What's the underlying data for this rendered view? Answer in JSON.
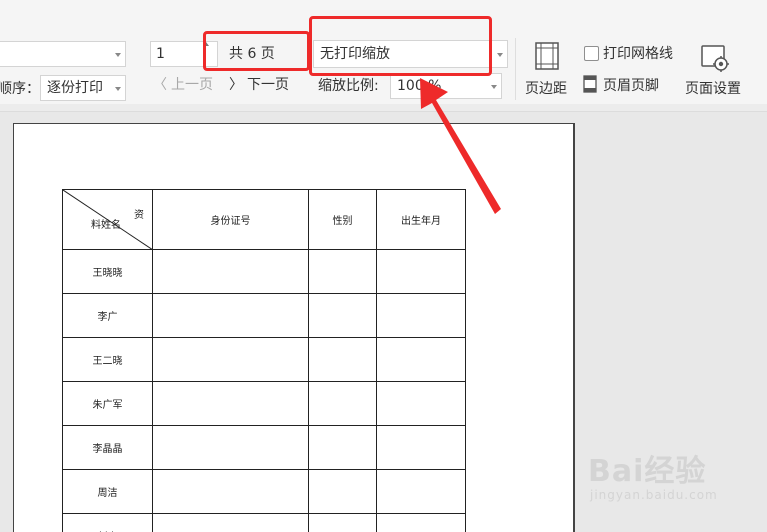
{
  "ribbon": {
    "order_label": "顺序：",
    "order_value": "逐份打印",
    "page_input_value": "1",
    "total_pages": "共 6 页",
    "prev_page": "上一页",
    "next_page": "下一页",
    "scale_mode": "无打印缩放",
    "zoom_label": "缩放比例:",
    "zoom_value": "100 %",
    "margins_label": "页边距",
    "print_gridlines_label": "打印网格线",
    "print_gridlines_checked": false,
    "header_footer_label": "页眉页脚",
    "page_setup_label": "页面设置"
  },
  "sheet": {
    "diag_top_right": "资",
    "diag_bottom_left": "料姓名",
    "headers": [
      "身份证号",
      "性别",
      "出生年月"
    ],
    "names": [
      "王晓晓",
      "李广",
      "王二晓",
      "朱广军",
      "李晶晶",
      "周洁",
      "刘小"
    ]
  },
  "watermark": {
    "brand": "Bai经验",
    "url": "jingyan.baidu.com"
  },
  "colors": {
    "annotation_red": "#ee2a2a"
  }
}
